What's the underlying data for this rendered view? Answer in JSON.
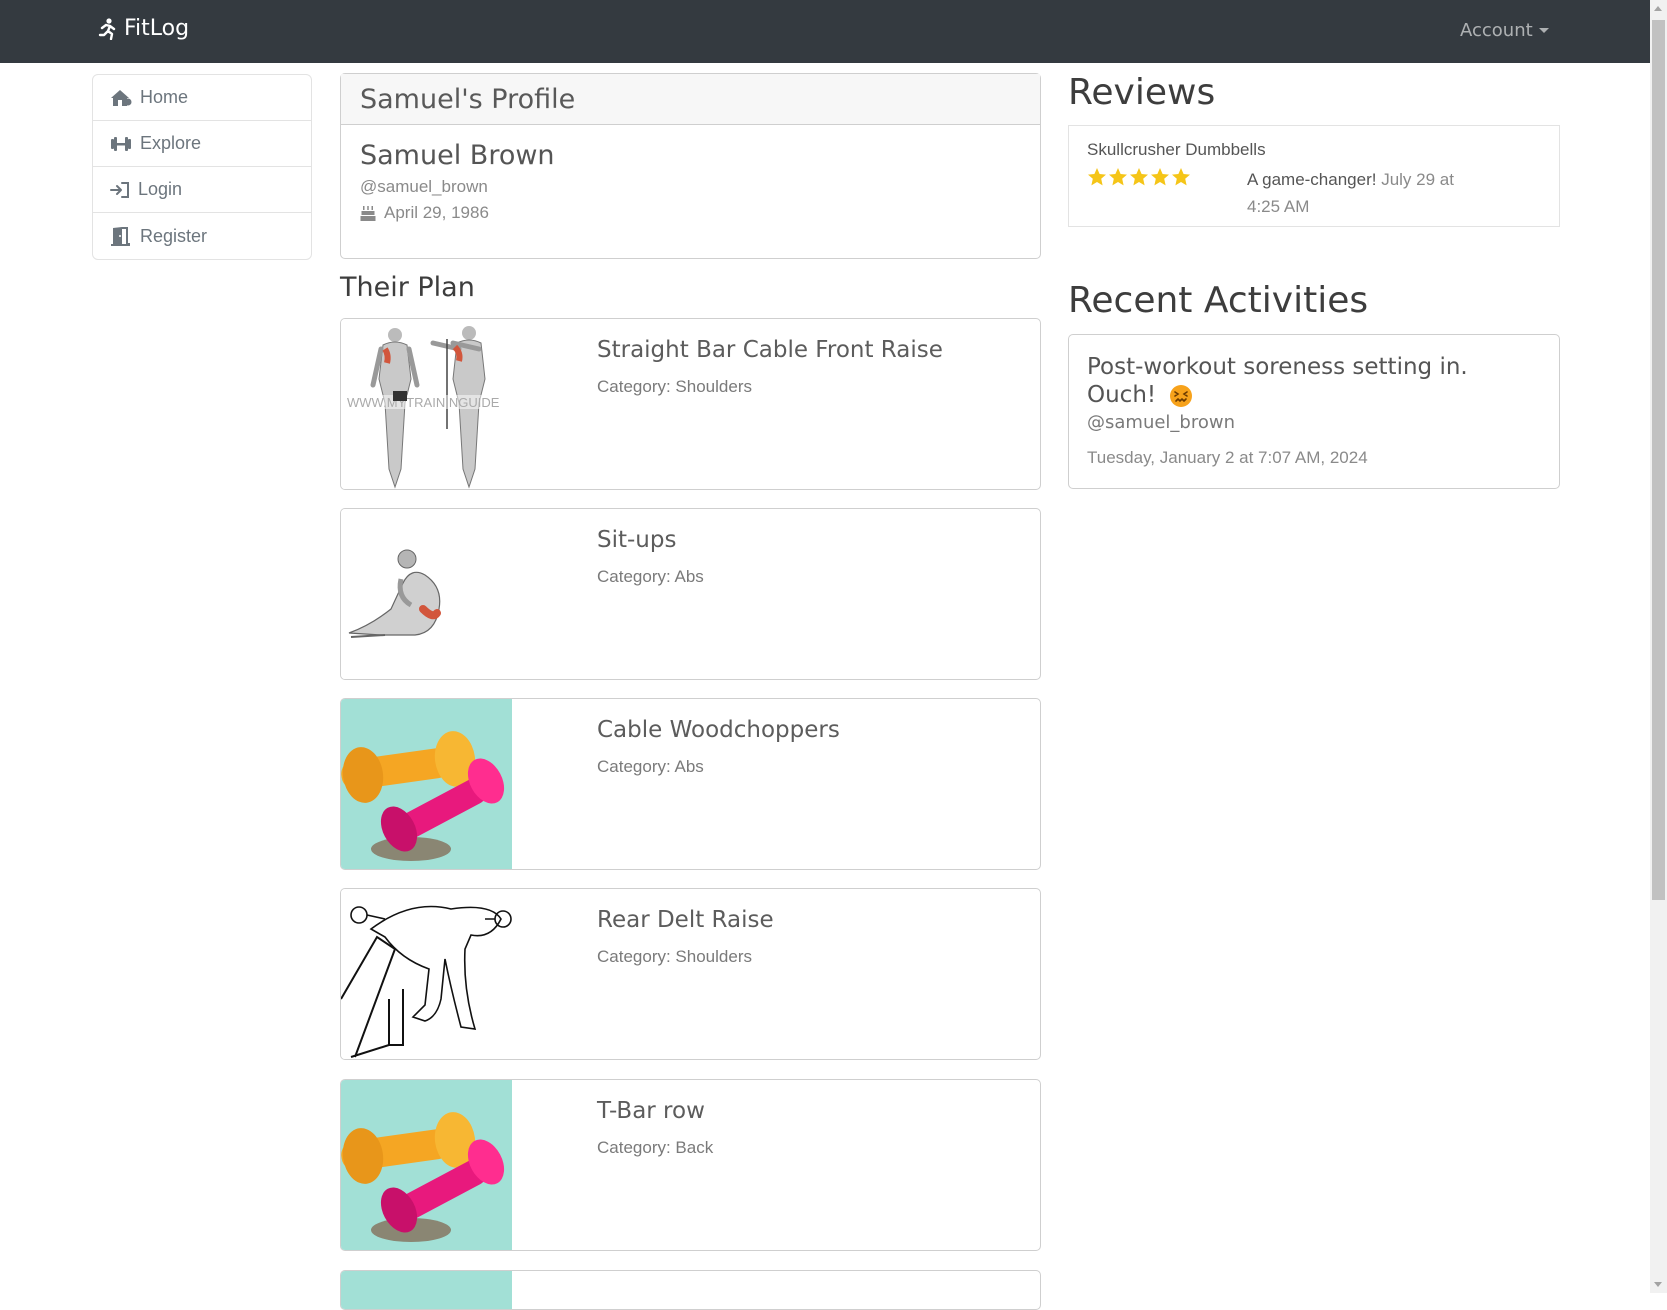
{
  "navbar": {
    "brand": "FitLog",
    "brand_icon": "running-person-icon",
    "account_label": "Account"
  },
  "sidebar": {
    "items": [
      {
        "label": "Home",
        "icon": "home-icon"
      },
      {
        "label": "Explore",
        "icon": "dumbbell-icon"
      },
      {
        "label": "Login",
        "icon": "sign-in-icon"
      },
      {
        "label": "Register",
        "icon": "door-open-icon"
      }
    ]
  },
  "profile": {
    "header": "Samuel's Profile",
    "name": "Samuel Brown",
    "handle": "@samuel_brown",
    "birthday": "April 29, 1986",
    "birthday_icon": "birthday-cake-icon"
  },
  "plan": {
    "title": "Their Plan",
    "items": [
      {
        "name": "Straight Bar Cable Front Raise",
        "category": "Category: Shoulders",
        "image": "anatomy-illustration"
      },
      {
        "name": "Sit-ups",
        "category": "Category: Abs",
        "image": "situp-illustration"
      },
      {
        "name": "Cable Woodchoppers",
        "category": "Category: Abs",
        "image": "dumbbells-photo"
      },
      {
        "name": "Rear Delt Raise",
        "category": "Category: Shoulders",
        "image": "line-drawing"
      },
      {
        "name": "T-Bar row",
        "category": "Category: Back",
        "image": "dumbbells-photo"
      }
    ]
  },
  "reviews": {
    "title": "Reviews",
    "items": [
      {
        "product": "Skullcrusher Dumbbells",
        "rating": 5,
        "text": "A game-changer!",
        "date": "July 29 at 4:25 AM"
      }
    ]
  },
  "activities": {
    "title": "Recent Activities",
    "items": [
      {
        "text": "Post-workout soreness setting in. Ouch!",
        "emoji": "confounded-face-emoji",
        "user": "@samuel_brown",
        "time": "Tuesday, January 2 at 7:07 AM, 2024"
      }
    ]
  },
  "colors": {
    "navbar": "#343a40",
    "star": "#f5c518",
    "thumb_teal": "#a2e0d6",
    "dumbbell_yellow": "#f5a623",
    "dumbbell_pink": "#e8197d"
  }
}
